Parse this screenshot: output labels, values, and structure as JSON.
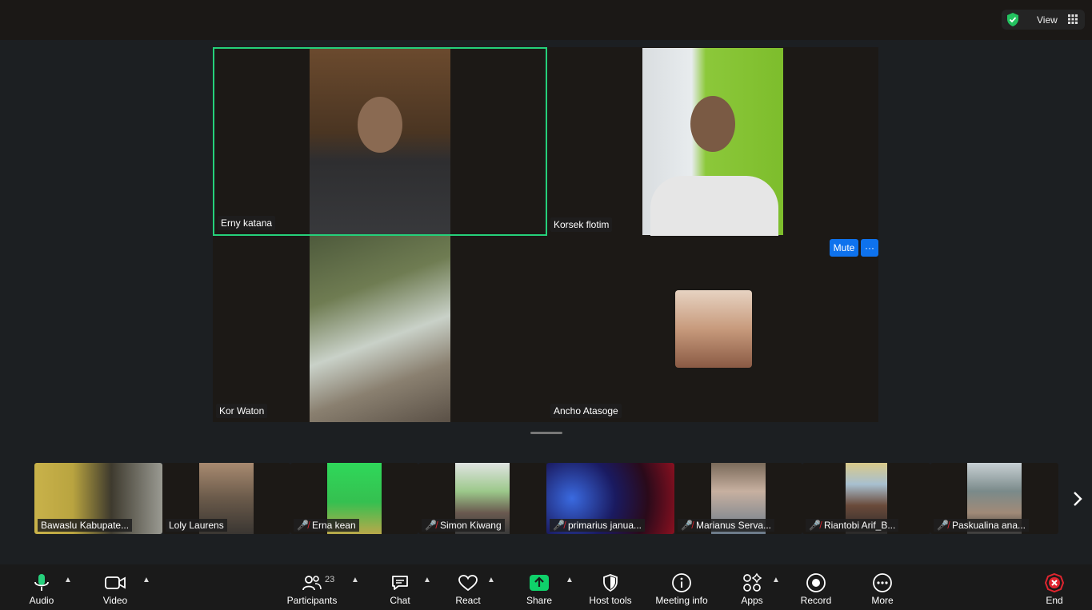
{
  "header": {
    "view_label": "View"
  },
  "main_tiles": [
    {
      "name": "Erny katana"
    },
    {
      "name": "Korsek flotim"
    },
    {
      "name": "Kor Waton"
    },
    {
      "name": "Ancho Atasoge"
    }
  ],
  "tile_controls": {
    "mute_label": "Mute",
    "more_label": "···"
  },
  "strip": [
    {
      "name": "Bawaslu Kabupate...",
      "muted": false
    },
    {
      "name": "Loly Laurens",
      "muted": false
    },
    {
      "name": "Erna kean",
      "muted": true
    },
    {
      "name": "Simon Kiwang",
      "muted": true
    },
    {
      "name": "primarius janua...",
      "muted": true
    },
    {
      "name": "Marianus Serva...",
      "muted": true
    },
    {
      "name": "Riantobi Arif_B...",
      "muted": true
    },
    {
      "name": "Paskualina ana...",
      "muted": true
    }
  ],
  "toolbar": {
    "audio": "Audio",
    "video": "Video",
    "participants": "Participants",
    "participants_count": "23",
    "chat": "Chat",
    "react": "React",
    "share": "Share",
    "host_tools": "Host tools",
    "meeting_info": "Meeting info",
    "apps": "Apps",
    "record": "Record",
    "more": "More",
    "end": "End"
  },
  "colors": {
    "active_speaker": "#25d07a",
    "share_green": "#0fd16a",
    "button_blue": "#0e72ed",
    "end_red": "#e0252f",
    "muted_red": "#e0252f"
  }
}
